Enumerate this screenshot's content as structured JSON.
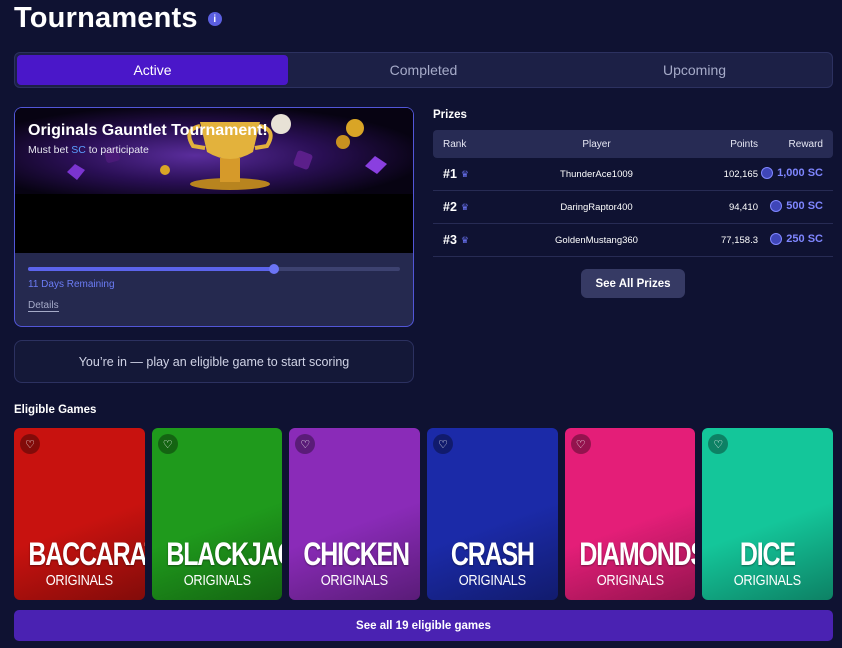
{
  "page": {
    "title": "Tournaments",
    "info_icon": "i"
  },
  "tabs": [
    {
      "label": "Active",
      "active": true
    },
    {
      "label": "Completed",
      "active": false
    },
    {
      "label": "Upcoming",
      "active": false
    }
  ],
  "tournament": {
    "name": "Originals Gauntlet Tournament!",
    "subtitle_prefix": "Must bet ",
    "subtitle_currency": "SC",
    "subtitle_suffix": " to participate",
    "progress_percent": 66,
    "remaining": "11 Days Remaining",
    "details_label": "Details"
  },
  "status_message": "You’re in — play an eligible game to start scoring",
  "prizes": {
    "title": "Prizes",
    "columns": {
      "rank": "Rank",
      "player": "Player",
      "points": "Points",
      "reward": "Reward"
    },
    "rows": [
      {
        "rank": "#1",
        "player": "ThunderAce1009",
        "points": "102,165",
        "reward": "1,000 SC"
      },
      {
        "rank": "#2",
        "player": "DaringRaptor400",
        "points": "94,410",
        "reward": "500 SC"
      },
      {
        "rank": "#3",
        "player": "GoldenMustang360",
        "points": "77,158.3",
        "reward": "250 SC"
      }
    ],
    "see_all_label": "See All Prizes"
  },
  "eligible": {
    "title": "Eligible Games",
    "games": [
      {
        "name": "BACCARAT",
        "sub": "ORIGINALS",
        "bg": "#c8120f"
      },
      {
        "name": "BLACKJACK",
        "sub": "ORIGINALS",
        "bg": "#1f9a1c"
      },
      {
        "name": "CHICKEN",
        "sub": "ORIGINALS",
        "bg": "#8a2bb8"
      },
      {
        "name": "CRASH",
        "sub": "ORIGINALS",
        "bg": "#1b2aa8"
      },
      {
        "name": "DIAMONDS",
        "sub": "ORIGINALS",
        "bg": "#e41e78"
      },
      {
        "name": "DICE",
        "sub": "ORIGINALS",
        "bg": "#14c69a"
      }
    ],
    "see_all_label": "See all 19 eligible games"
  },
  "colors": {
    "accent": "#4a17c9",
    "progress": "#5c64ec",
    "reward": "#7f86ff",
    "background": "#0f1232"
  }
}
